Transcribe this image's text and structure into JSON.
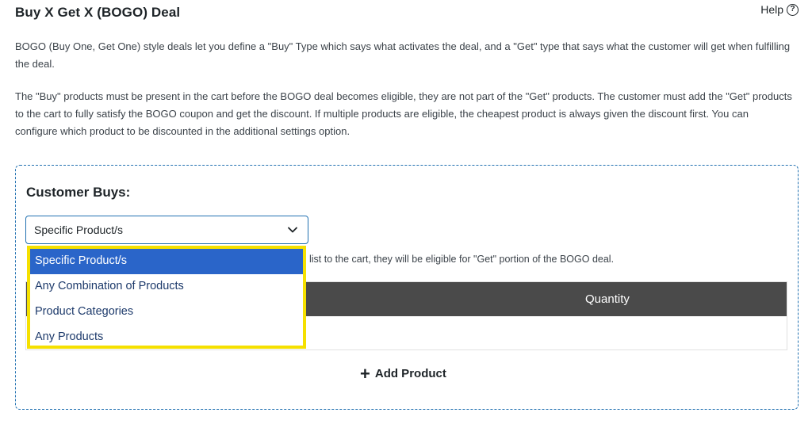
{
  "header": {
    "title": "Buy X Get X (BOGO) Deal",
    "help_label": "Help",
    "help_icon": "question-circle-icon"
  },
  "descriptions": {
    "intro": "BOGO (Buy One, Get One) style deals let you define a \"Buy\" Type which says what activates the deal, and a \"Get\" type that says what the customer will get when fulfilling the deal.",
    "details": "The \"Buy\" products must be present in the cart before the BOGO deal becomes eligible, they are not part of the \"Get\" products. The customer must add the \"Get\" products to the cart to fully satisfy the BOGO coupon and get the discount. If multiple products are eligible, the cheapest product is always given the discount first. You can configure which product to be discounted in the additional settings option."
  },
  "customer_buys": {
    "title": "Customer Buys:",
    "select_value": "Specific Product/s",
    "helper_text": "list to the cart, they will be eligible for \"Get\" portion of the BOGO deal.",
    "table": {
      "columns": [
        "Quantity"
      ]
    },
    "add_product_label": "Add Product",
    "dropdown_options": [
      {
        "label": "Specific Product/s",
        "selected": true
      },
      {
        "label": "Any Combination of Products",
        "selected": false
      },
      {
        "label": "Product Categories",
        "selected": false
      },
      {
        "label": "Any Products",
        "selected": false
      }
    ]
  },
  "colors": {
    "accent_border": "#2271b1",
    "highlight": "#f5e000",
    "selected_option": "#2a65c9",
    "table_header": "#4a4a4a"
  }
}
